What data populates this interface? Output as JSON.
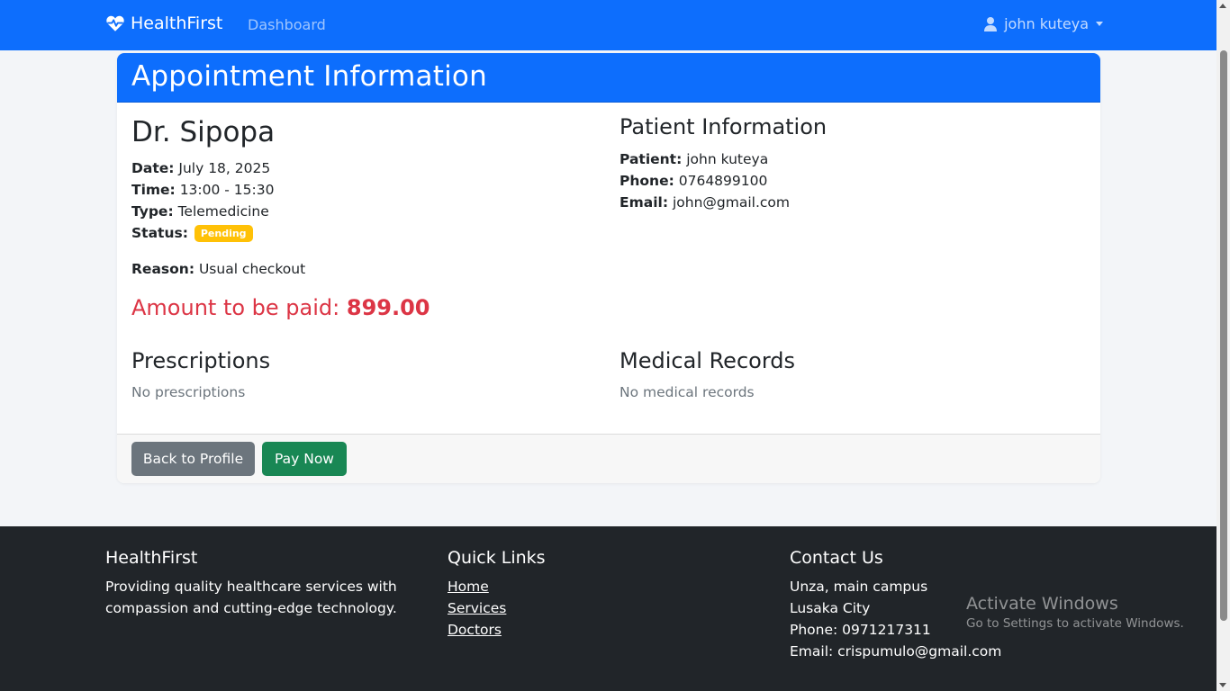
{
  "navbar": {
    "brand": "HealthFirst",
    "dashboard_link": "Dashboard",
    "user_name": "john kuteya",
    "brand_icon": "heart-pulse-icon",
    "user_icon": "user-icon",
    "color": "#0d6efd"
  },
  "card": {
    "header_title": "Appointment Information",
    "doctor_name": "Dr. Sipopa",
    "details": {
      "date_label": "Date:",
      "date_value": "July 18, 2025",
      "time_label": "Time:",
      "time_value": "13:00 - 15:30",
      "type_label": "Type:",
      "type_value": "Telemedicine",
      "status_label": "Status:",
      "status_badge": "Pending",
      "status_color": "#ffc107",
      "reason_label": "Reason:",
      "reason_value": "Usual checkout"
    },
    "amount": {
      "label": "Amount to be paid:",
      "value": "899.00",
      "color": "#dc3545"
    },
    "patient": {
      "title": "Patient Information",
      "patient_label": "Patient:",
      "patient_value": "john kuteya",
      "phone_label": "Phone:",
      "phone_value": "0764899100",
      "email_label": "Email:",
      "email_value": "john@gmail.com"
    },
    "prescriptions": {
      "title": "Prescriptions",
      "empty_text": "No prescriptions"
    },
    "medical_records": {
      "title": "Medical Records",
      "empty_text": "No medical records"
    },
    "buttons": {
      "back_label": "Back to Profile",
      "pay_label": "Pay Now"
    }
  },
  "footer": {
    "about": {
      "title": "HealthFirst",
      "line1": "Providing quality healthcare services with",
      "line2": "compassion and cutting-edge technology."
    },
    "quick_links": {
      "title": "Quick Links",
      "links": [
        "Home",
        "Services",
        "Doctors"
      ]
    },
    "contact": {
      "title": "Contact Us",
      "address1": "Unza, main campus",
      "address2": "Lusaka City",
      "phone": "Phone: 0971217311",
      "email": "Email: crispumulo@gmail.com"
    }
  },
  "watermark": {
    "title": "Activate Windows",
    "subtitle": "Go to Settings to activate Windows."
  }
}
